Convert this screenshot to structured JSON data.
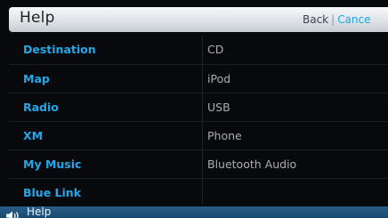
{
  "header": {
    "title": "Help",
    "back_label": "Back",
    "separator": "|",
    "cancel_label": "Cance"
  },
  "left_items": [
    "Destination",
    "Map",
    "Radio",
    "XM",
    "My Music",
    "Blue Link"
  ],
  "right_items": [
    "CD",
    "iPod",
    "USB",
    "Phone",
    "Bluetooth Audio",
    ""
  ],
  "statusbar": {
    "icon": "speaker-icon",
    "label": "Help"
  },
  "colors": {
    "accent": "#22a8ea",
    "header_bg": "#e4e8ec",
    "background": "#07090c",
    "statusbar": "#1f5379"
  }
}
